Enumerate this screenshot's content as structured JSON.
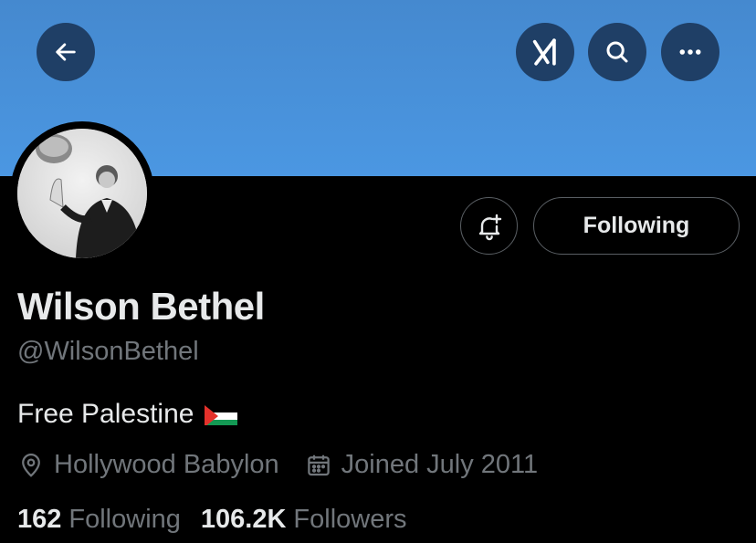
{
  "header": {
    "back_icon": "arrow-left-icon",
    "grok_icon": "grok-icon",
    "search_icon": "search-icon",
    "more_icon": "more-horizontal-icon",
    "banner_color": "#4b97e2",
    "button_color": "#1f3f66"
  },
  "profile": {
    "display_name": "Wilson Bethel",
    "handle": "@WilsonBethel",
    "bio": "Free Palestine",
    "bio_emoji": "palestine-flag",
    "location": "Hollywood Babylon",
    "joined": "Joined July 2011",
    "following_count": "162",
    "following_label": "Following",
    "followers_count": "106.2K",
    "followers_label": "Followers"
  },
  "actions": {
    "notify_icon": "bell-plus-icon",
    "follow_label": "Following"
  }
}
